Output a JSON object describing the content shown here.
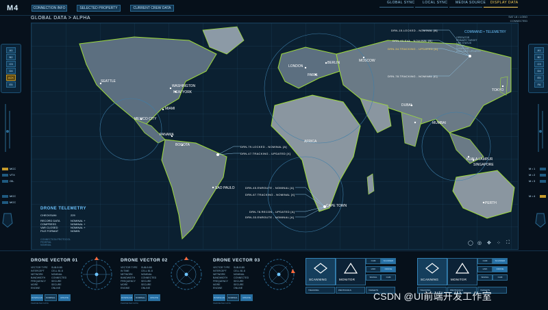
{
  "app": {
    "logo": "M4",
    "top_tabs": [
      "CONNECTION INFO",
      "SELECTED PROPERTY SETTINGS",
      "CURRENT CREW DATA STATE"
    ],
    "top_links": [
      {
        "label": "GLOBAL SYNC",
        "active": false
      },
      {
        "label": "LOCAL SYNC",
        "active": false
      },
      {
        "label": "MEDIA SOURCE",
        "active": false
      },
      {
        "label": "DISPLAY DATA",
        "active": true
      }
    ],
    "breadcrumb": "GLOBAL DATA > ALPHA",
    "sat_label": "SAT L8 • LOBO",
    "sat_sub": "CONNECTED"
  },
  "left_sidebar": {
    "panel_buttons": [
      "A1",
      "B2",
      "C3",
      "D4",
      "ACK",
      "E5"
    ],
    "tags": [
      {
        "label": "MCC",
        "warn": true
      },
      {
        "label": "VTX",
        "warn": false
      },
      {
        "label": "OIL",
        "warn": false
      },
      {
        "label": "MCC",
        "warn": false
      },
      {
        "label": "MCC",
        "warn": false
      }
    ]
  },
  "right_sidebar": {
    "panel_buttons": [
      "A1",
      "B2",
      "C3",
      "D4",
      "E5",
      "F6"
    ],
    "tags": [
      "M • 1",
      "M • 2",
      "M • 3",
      "M • 4"
    ]
  },
  "map": {
    "cities": [
      "SEATTLE",
      "NEW YORK",
      "WASHINGTON",
      "MIAMI",
      "MEXICO CITY",
      "PANAMA",
      "BOGOTA",
      "SAO PAULO",
      "LONDON",
      "BERLIN",
      "PARIS",
      "MOSCOW",
      "AFRICA",
      "CAPE TOWN",
      "DUBAI",
      "MUMBAI",
      "TOKYO",
      "KUALA LAMPUR",
      "SINGAPORE",
      "PERTH"
    ],
    "drone_labels_top": [
      {
        "text": "DRN-15.LOCKED - NOMINAL [B]",
        "warn": false
      },
      {
        "text": "DRN-40.EVA - NOMINAL [B]",
        "warn": false
      },
      {
        "text": "DRN-34.TRACKING - UPDATED [A]",
        "warn": true
      },
      {
        "text": "DRN-78.TRACKING - NOMINAL [C]",
        "warn": false
      }
    ],
    "drone_labels_sa": [
      {
        "text": "DRN-79.LOCKED - NOMINAL [A]",
        "warn": false
      },
      {
        "text": "DRN-47.TRACKING - UPDATED [X]",
        "warn": false
      }
    ],
    "drone_labels_af": [
      {
        "text": "DRN-45.ENROUTE - NOMINAL [A]",
        "warn": false
      },
      {
        "text": "DRN-67.TRACKING - NOMINAL [X]",
        "warn": false
      },
      {
        "text": "DRN-78.RECON - UPDATED [A]",
        "warn": false
      },
      {
        "text": "DRN-33.ENROUTE - NOMINAL [A]",
        "warn": false
      }
    ],
    "command": {
      "title": "COMMAND • TELEMETRY",
      "rows": [
        "OPERATOR",
        "PRIMARY TARGET",
        "LINK STATUS",
        "UPLINK",
        "DOWNLINK",
        "AVAILABLE UPDATES"
      ]
    },
    "telemetry": {
      "title": "DRONE TELEMETRY",
      "rows": [
        {
          "k": "CHECKSUM:",
          "v": "229"
        },
        {
          "k": "RECORD DATA",
          "v": "NOMINAL +"
        },
        {
          "k": "COMPRESS",
          "v": "NOMINAL +"
        },
        {
          "k": "VAR CLOSED",
          "v": "NOMINAL +"
        },
        {
          "k": "FILE FORMAT",
          "v": "NOMIN"
        }
      ],
      "foot": [
        "CONNECTION PROTOCOL",
        "FEDERAL",
        "NOMINAL"
      ]
    },
    "controls": [
      "◯",
      "◎",
      "✥",
      "⁘",
      "⛶"
    ]
  },
  "bottom": {
    "vectors": [
      {
        "title": "DRONE VECTOR 01",
        "stats": [
          [
            "VECTOR TYPE",
            "SUB-B.B5"
          ],
          [
            "INTERCEPT",
            "CELL B1.8"
          ],
          [
            "NETWORK",
            "NOMINAL"
          ],
          [
            "BANDWIDTH",
            "CONNECTED"
          ],
          [
            "FREQUENCY",
            "SECURE"
          ],
          [
            "MORE",
            "SECURE"
          ],
          [
            "ENGINE",
            "ONLINE"
          ]
        ],
        "chips": [
          "DOWNLOAD",
          "NOMINAL",
          "UPDATE"
        ],
        "foot": "PERIMETER DATA"
      },
      {
        "title": "DRONE VECTOR 02",
        "stats": [
          [
            "VECTOR TYPE",
            "SUB-B.B5"
          ],
          [
            "IN TIME",
            "CELL B1.8"
          ],
          [
            "NETWORK",
            "NOMINAL"
          ],
          [
            "BANDWIDTH",
            "CONNECTED"
          ],
          [
            "FREQUENCY",
            "SECURE"
          ],
          [
            "MORE",
            "SECURE"
          ],
          [
            "ENGINE",
            "ONLINE"
          ]
        ],
        "chips": [
          "DOWNLOAD",
          "NOMINAL",
          "UPDATE"
        ],
        "foot": "PERIMETER DATA"
      },
      {
        "title": "DRONE VECTOR 03",
        "stats": [
          [
            "VECTOR TYPE",
            "SUB-B.B5"
          ],
          [
            "INTERCEPT",
            "CELL B1.8"
          ],
          [
            "NETWORK",
            "NOMINAL"
          ],
          [
            "BANDWIDTH",
            "CONNECTED"
          ],
          [
            "FREQUENCY",
            "SECURE"
          ],
          [
            "MORE",
            "SECURE"
          ],
          [
            "ENGINE",
            "ONLINE"
          ]
        ],
        "chips": [
          "DOWNLOAD",
          "NOMINAL",
          "UPDATE"
        ],
        "foot": "PERIMETER DATA"
      }
    ],
    "monitors": [
      {
        "tile1": "SCANNING",
        "tile2": "MONITOR",
        "cells": [
          "CAM",
          "SCANNER",
          "LINK",
          "DRONE",
          "SIGNAL",
          "CAM"
        ],
        "bars": [
          "TRACKING",
          "PROTOCOLS",
          "TARGETS"
        ]
      },
      {
        "tile1": "SCANNING",
        "tile2": "MONITOR",
        "cells": [
          "CAM",
          "SCANNER",
          "LINK",
          "DRONE",
          "SIGNAL",
          "CAM"
        ],
        "bars": [
          "TRACKING",
          "PROTOCOLS",
          "TARGETS"
        ]
      }
    ]
  },
  "watermark": "CSDN @UI前端开发工作室"
}
